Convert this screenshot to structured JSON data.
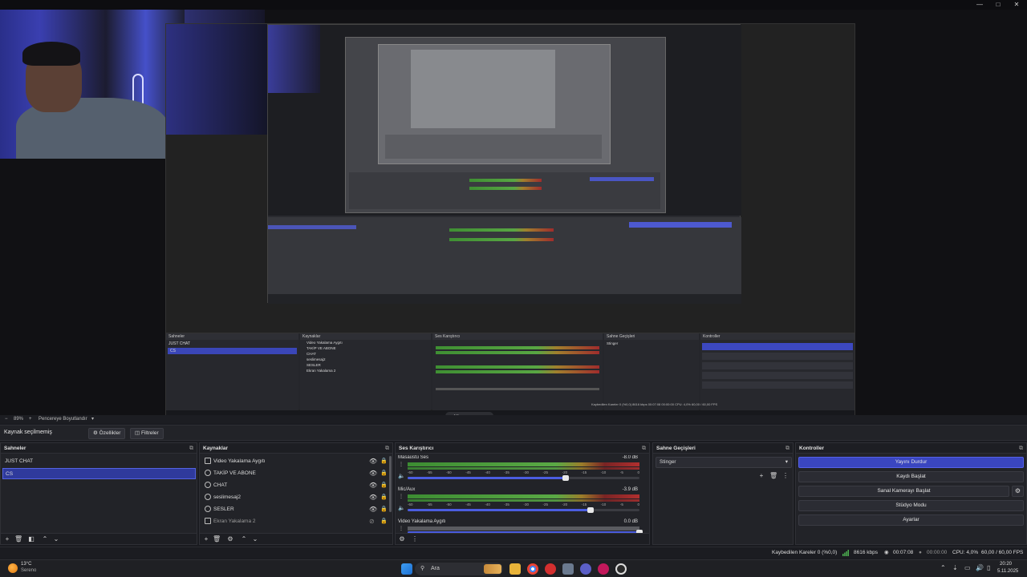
{
  "window": {
    "minimize": "—",
    "maximize": "□",
    "close": "✕"
  },
  "preview": {
    "nested_dock": {
      "scenes_title": "Sahneler",
      "scene1": "JUST CHAT",
      "scene2": "CS",
      "sources_title": "Kaynaklar",
      "src": [
        "Video Yakalama Aygıtı",
        "TAKİP VE ABONE",
        "CHAT",
        "seslimesaj2",
        "SESLER",
        "Ekran Yakalama 2"
      ],
      "mixer_title": "Ses Karıştırıcı",
      "transitions_title": "Sahne Geçişleri",
      "controls_title": "Kontroller",
      "stinger": "Stinger",
      "status": "Kaybedilen Kareler 0 (%0,0)   8616 kbps   00:07:08   00:00:00   CPU: 4,0%   60,00 / 60,00 FPS",
      "search": "Ara"
    }
  },
  "zoom": {
    "value": "89%",
    "sep": "+",
    "label": "Pencereye Boyutlandır"
  },
  "properties_bar": {
    "no_source": "Kaynak seçilmemiş",
    "properties": "Özellikler",
    "filters": "Filtreler"
  },
  "scenes": {
    "title": "Sahneler",
    "items": [
      "JUST CHAT",
      "CS"
    ]
  },
  "sources": {
    "title": "Kaynaklar",
    "items": [
      "Video Yakalama Aygıtı",
      "TAKİP VE ABONE",
      "CHAT",
      "seslimesaj2",
      "SESLER",
      "Ekran Yakalama 2"
    ]
  },
  "mixer": {
    "title": "Ses Karıştırıcı",
    "channels": [
      {
        "name": "Masaüstü Ses",
        "db": "-8.0 dB",
        "volume": 0.68
      },
      {
        "name": "Mic/Aux",
        "db": "-3.9 dB",
        "volume": 0.79
      },
      {
        "name": "Video Yakalama Aygıtı",
        "db": "0.0 dB",
        "volume": 1.0
      }
    ],
    "ticks": [
      "-60",
      "-55",
      "-50",
      "-45",
      "-40",
      "-35",
      "-30",
      "-25",
      "-20",
      "-15",
      "-10",
      "-5",
      "0"
    ]
  },
  "transitions": {
    "title": "Sahne Geçişleri",
    "selected": "Stinger"
  },
  "controls": {
    "title": "Kontroller",
    "stop_stream": "Yayını Durdur",
    "start_recording": "Kaydı Başlat",
    "start_virtualcam": "Sanal Kamerayı Başlat",
    "studio_mode": "Stüdyo Modu",
    "settings": "Ayarlar"
  },
  "status": {
    "dropped": "Kaybedilen Kareler 0 (%0,0)",
    "bitrate": "8616 kbps",
    "stream_time": "00:07:08",
    "rec_time": "00:00:00",
    "cpu": "CPU: 4,0%",
    "fps": "60,00 / 60,00 FPS"
  },
  "taskbar": {
    "weather_temp": "13°C",
    "weather_text": "Serenо",
    "search": "Ara",
    "time": "20:20",
    "date": "5.11.2025"
  },
  "colors": {
    "accent": "#3a46c0",
    "meter_green": "#5aa945",
    "meter_yellow": "#9a7d2a",
    "meter_red": "#b12f2f"
  }
}
